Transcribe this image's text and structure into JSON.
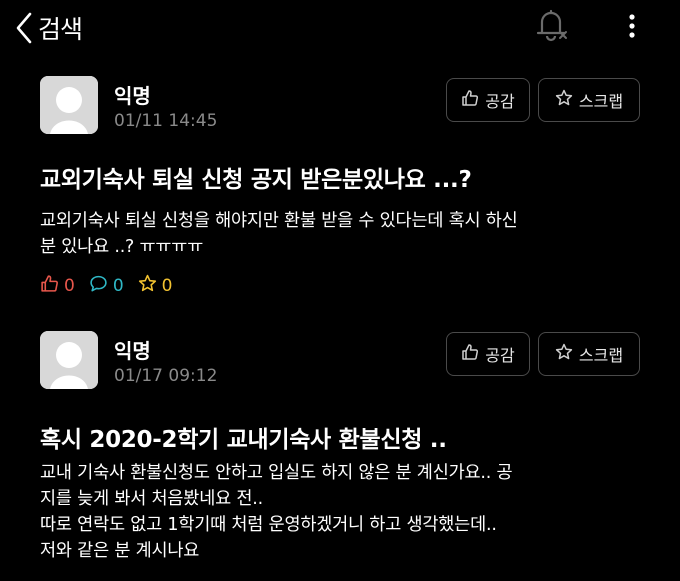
{
  "header": {
    "back_label": "검색",
    "icons": [
      "chevron-left-icon",
      "bell-off-icon",
      "more-vertical-icon"
    ]
  },
  "colors": {
    "background": "#000000",
    "meta_gray": "#8a8a8a",
    "like_red": "#e8574c",
    "comment_cyan": "#2fb8c6",
    "scrap_yellow": "#f2c230"
  },
  "posts": [
    {
      "author": "익명",
      "time": "01/11 14:45",
      "like_button": "공감",
      "scrap_button": "스크랩",
      "title": "교외기숙사 퇴실 신청 공지 받은분있나요 ...?",
      "body_lines": [
        "교외기숙사 퇴실 신청을 해야지만 환불 받을 수 있다는데 혹시 하신",
        "분 있나요 ..? ㅠㅠㅠㅠ"
      ],
      "likes": "0",
      "comments": "0",
      "scraps": "0"
    },
    {
      "author": "익명",
      "time": "01/17 09:12",
      "like_button": "공감",
      "scrap_button": "스크랩",
      "title": "혹시 2020-2학기 교내기숙사 환불신청 ..",
      "body_lines": [
        "교내 기숙사 환불신청도 안하고 입실도 하지 않은 분 계신가요.. 공",
        "지를 늦게 봐서 처음봤네요 전..",
        "따로 연락도 없고 1학기때 처럼 운영하겠거니 하고 생각했는데..",
        "저와 같은 분 계시나요"
      ]
    }
  ]
}
